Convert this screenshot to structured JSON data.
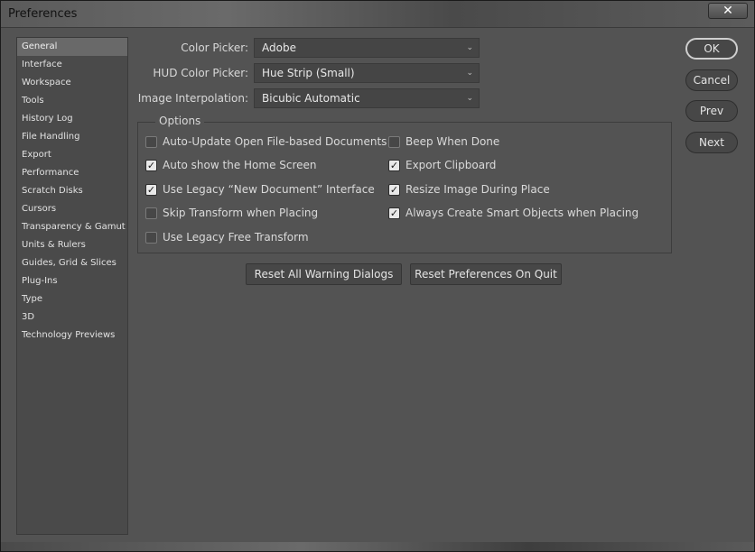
{
  "window": {
    "title": "Preferences",
    "close_label": "✕"
  },
  "sidebar": {
    "items": [
      {
        "label": "General",
        "active": true
      },
      {
        "label": "Interface"
      },
      {
        "label": "Workspace"
      },
      {
        "label": "Tools"
      },
      {
        "label": "History Log"
      },
      {
        "label": "File Handling"
      },
      {
        "label": "Export"
      },
      {
        "label": "Performance"
      },
      {
        "label": "Scratch Disks"
      },
      {
        "label": "Cursors"
      },
      {
        "label": "Transparency & Gamut"
      },
      {
        "label": "Units & Rulers"
      },
      {
        "label": "Guides, Grid & Slices"
      },
      {
        "label": "Plug-Ins"
      },
      {
        "label": "Type"
      },
      {
        "label": "3D"
      },
      {
        "label": "Technology Previews"
      }
    ]
  },
  "fields": {
    "color_picker": {
      "label": "Color Picker:",
      "value": "Adobe"
    },
    "hud_color_picker": {
      "label": "HUD Color Picker:",
      "value": "Hue Strip (Small)"
    },
    "image_interpolation": {
      "label": "Image Interpolation:",
      "value": "Bicubic Automatic"
    }
  },
  "options": {
    "title": "Options",
    "left": [
      {
        "label": "Auto-Update Open File-based Documents",
        "checked": false
      },
      {
        "label": "Auto show the Home Screen",
        "checked": true
      },
      {
        "label": "Use Legacy “New Document” Interface",
        "checked": true
      },
      {
        "label": "Skip Transform when Placing",
        "checked": false
      },
      {
        "label": "Use Legacy Free Transform",
        "checked": false
      }
    ],
    "right": [
      {
        "label": "Beep When Done",
        "checked": false
      },
      {
        "label": "Export Clipboard",
        "checked": true
      },
      {
        "label": "Resize Image During Place",
        "checked": true
      },
      {
        "label": "Always Create Smart Objects when Placing",
        "checked": true
      }
    ]
  },
  "buttons": {
    "reset_warnings": "Reset All Warning Dialogs",
    "reset_prefs": "Reset Preferences On Quit",
    "ok": "OK",
    "cancel": "Cancel",
    "prev": "Prev",
    "next": "Next"
  },
  "checkmark": "✓",
  "chevron": "⌄"
}
